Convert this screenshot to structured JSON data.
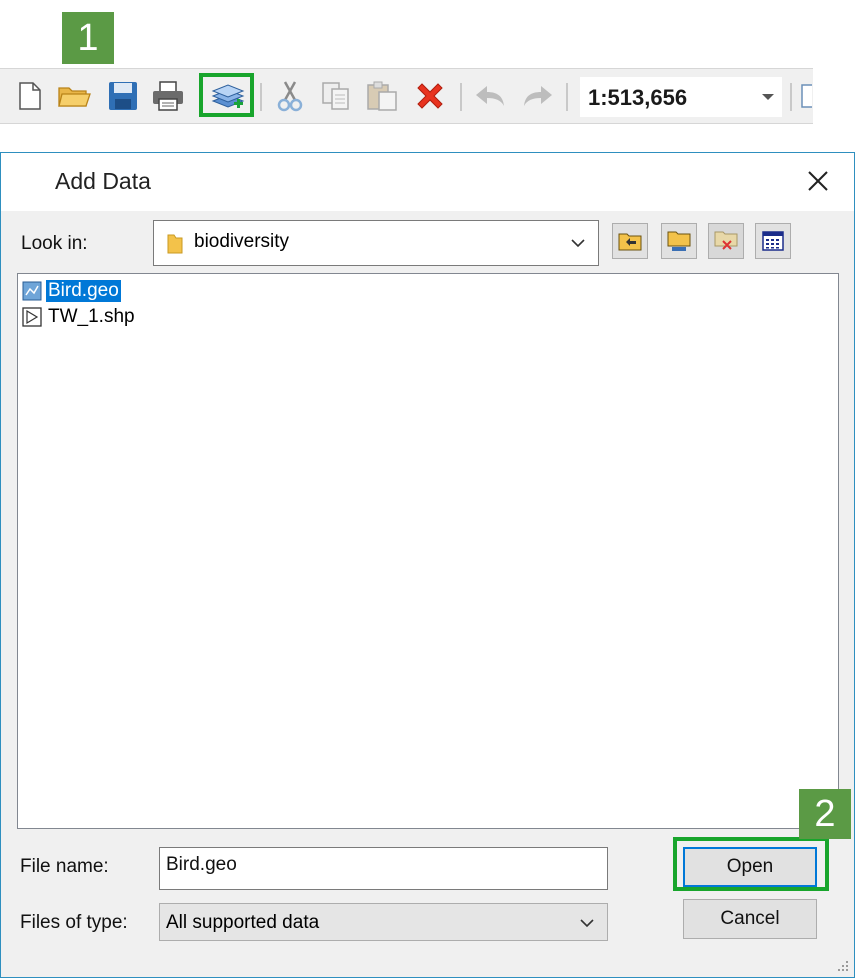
{
  "annotations": {
    "step1": "1",
    "step2": "2"
  },
  "toolbar": {
    "buttons": [
      {
        "name": "new-document-icon"
      },
      {
        "name": "open-folder-icon"
      },
      {
        "name": "save-icon"
      },
      {
        "name": "print-icon"
      },
      {
        "name": "add-data-icon"
      },
      {
        "name": "cut-icon"
      },
      {
        "name": "copy-icon"
      },
      {
        "name": "paste-icon"
      },
      {
        "name": "delete-icon"
      },
      {
        "name": "undo-icon"
      },
      {
        "name": "redo-icon"
      }
    ],
    "scale": "1:513,656"
  },
  "dialog": {
    "title": "Add Data",
    "look_in_label": "Look in:",
    "look_in_value": "biodiversity",
    "files": [
      {
        "name": "Bird.geo",
        "selected": true,
        "icon": "raster-dataset-icon"
      },
      {
        "name": "TW_1.shp",
        "selected": false,
        "icon": "shapefile-icon"
      }
    ],
    "file_name_label": "File name:",
    "file_name_value": "Bird.geo",
    "files_of_type_label": "Files of type:",
    "files_of_type_value": "All supported data",
    "open_label": "Open",
    "cancel_label": "Cancel"
  },
  "colors": {
    "highlight_box": "#18a52c",
    "badge": "#5b9a45",
    "selection": "#0078d7"
  }
}
